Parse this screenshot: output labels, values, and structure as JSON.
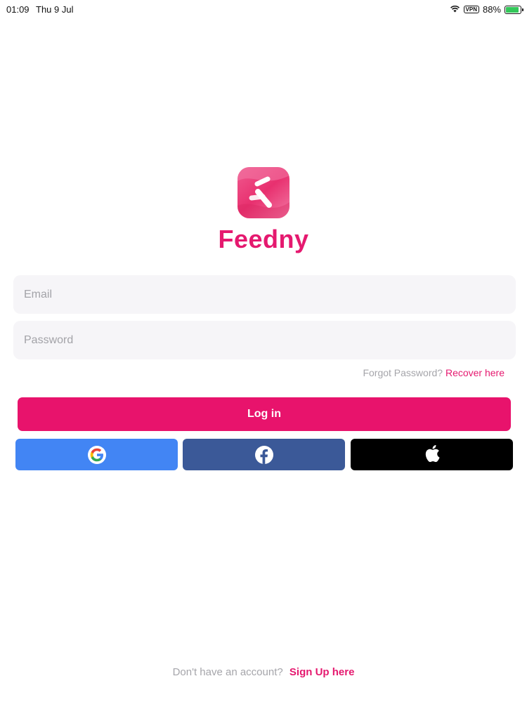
{
  "status_bar": {
    "time": "01:09",
    "date": "Thu 9 Jul",
    "vpn": "VPN",
    "battery": "88%",
    "battery_level": 0.88,
    "icons": [
      "wifi-icon",
      "vpn-icon",
      "battery-charging-icon"
    ]
  },
  "brand": {
    "name": "Feedny",
    "color": "#e5196f"
  },
  "form": {
    "email_placeholder": "Email",
    "email_value": "",
    "password_placeholder": "Password",
    "password_value": "",
    "forgot_text": "Forgot Password?",
    "recover_link": "Recover here",
    "login_label": "Log in",
    "login_color": "#e8136c"
  },
  "social": {
    "google": {
      "icon": "google-icon",
      "color": "#4285f4"
    },
    "facebook": {
      "icon": "facebook-icon",
      "color": "#3b5998"
    },
    "apple": {
      "icon": "apple-icon",
      "color": "#000000"
    }
  },
  "footer": {
    "signup_text": "Don't have an account?",
    "signup_link": "Sign Up here"
  }
}
